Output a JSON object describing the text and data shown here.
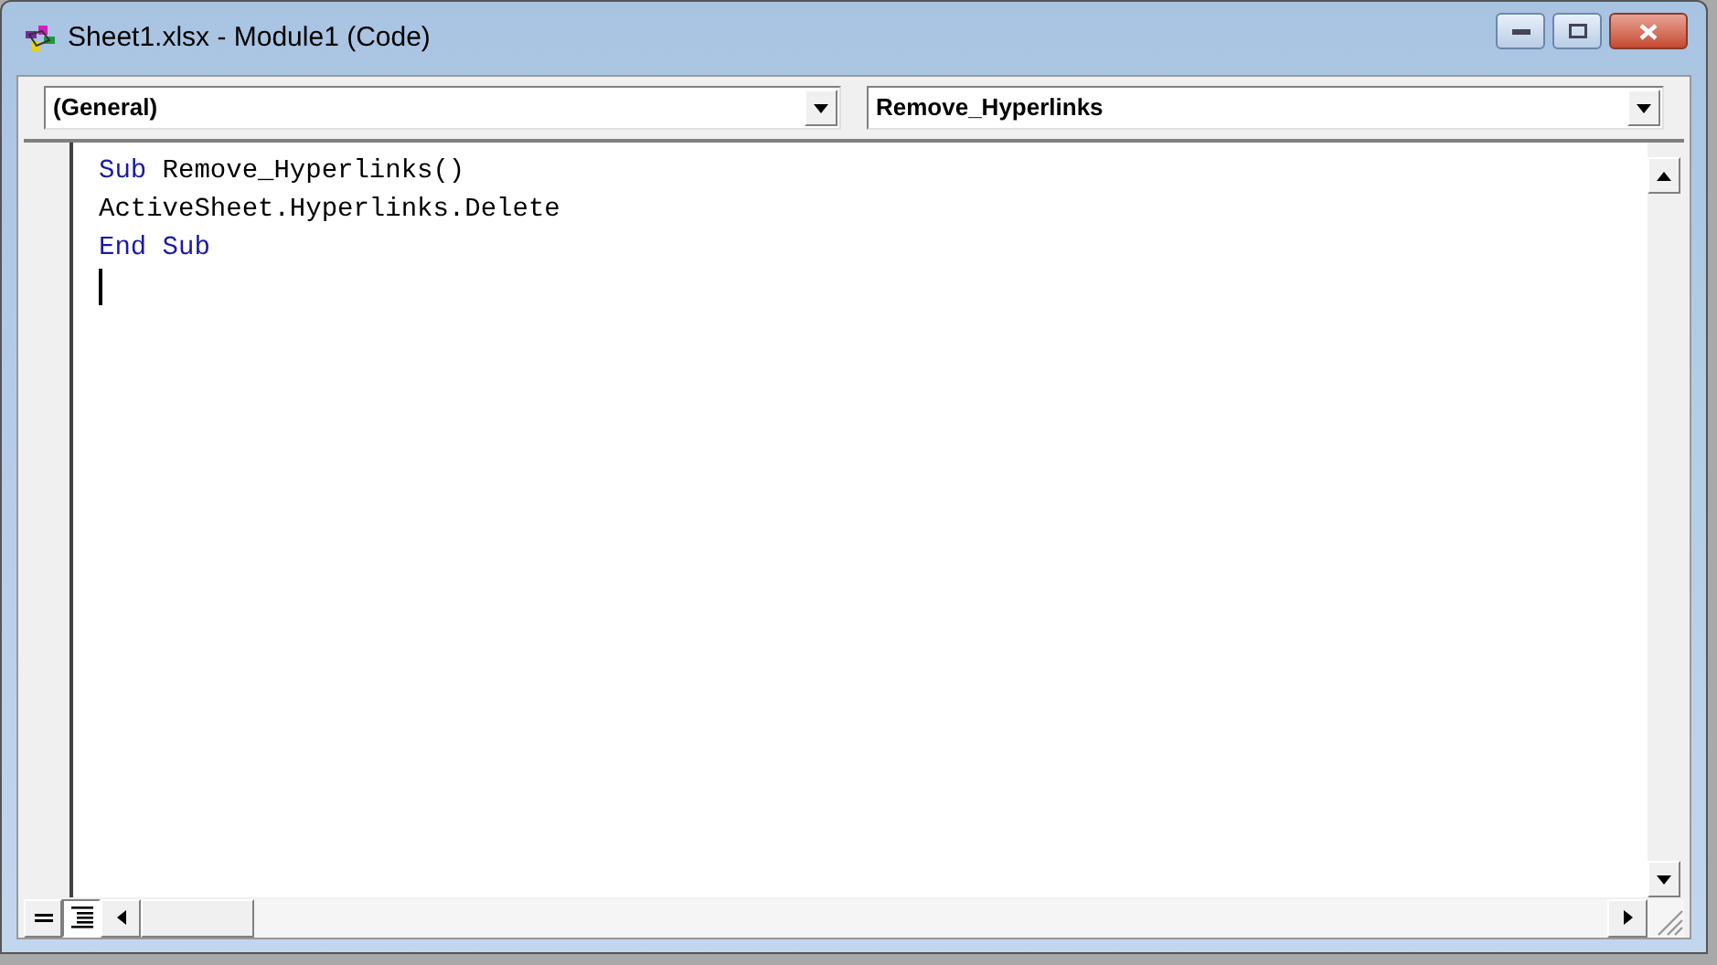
{
  "window": {
    "title": "Sheet1.xlsx - Module1 (Code)"
  },
  "object_dropdown": {
    "value": "(General)"
  },
  "procedure_dropdown": {
    "value": "Remove_Hyperlinks"
  },
  "code": {
    "lines": [
      {
        "tokens": [
          {
            "kind": "keyword",
            "text": "Sub"
          },
          {
            "kind": "plain",
            "text": " Remove_Hyperlinks()"
          }
        ]
      },
      {
        "tokens": [
          {
            "kind": "plain",
            "text": "ActiveSheet.Hyperlinks.Delete"
          }
        ]
      },
      {
        "tokens": [
          {
            "kind": "keyword",
            "text": "End Sub"
          }
        ]
      }
    ],
    "caret": true
  },
  "view_buttons": [
    {
      "kind": "procedure",
      "selected": false
    },
    {
      "kind": "full_module",
      "selected": true
    }
  ]
}
